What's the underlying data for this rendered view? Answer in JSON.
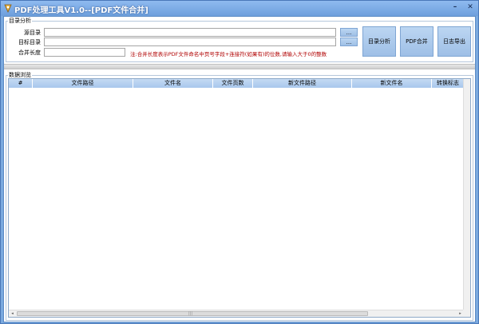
{
  "window": {
    "title": "PDF处理工具V1.0--[PDF文件合并]",
    "minimize_glyph": "–",
    "close_glyph": "✕"
  },
  "dir_group": {
    "title": "目录分析",
    "source_label": "源目录",
    "target_label": "目标目录",
    "merge_len_label": "合并长度",
    "source_value": "",
    "target_value": "",
    "merge_len_value": "",
    "browse_source": "...",
    "browse_target": "...",
    "note": "注:合并长度表示PDF文件命名中页号字段+连接符(如果有)的位数,请输入大于0的整数"
  },
  "buttons": {
    "analyze": "目录分析",
    "merge": "PDF合并",
    "export_log": "日志导出"
  },
  "preview": {
    "title": "数据浏览",
    "columns": [
      "#",
      "文件路径",
      "文件名",
      "文件页数",
      "新文件路径",
      "新文件名",
      "转换标志"
    ]
  },
  "scroll": {
    "left": "◂",
    "right": "▸",
    "grip": "|||"
  },
  "colors": {
    "title_bar": "#7aa9df",
    "header": "#a8c7ec",
    "note_text": "#b00000"
  }
}
